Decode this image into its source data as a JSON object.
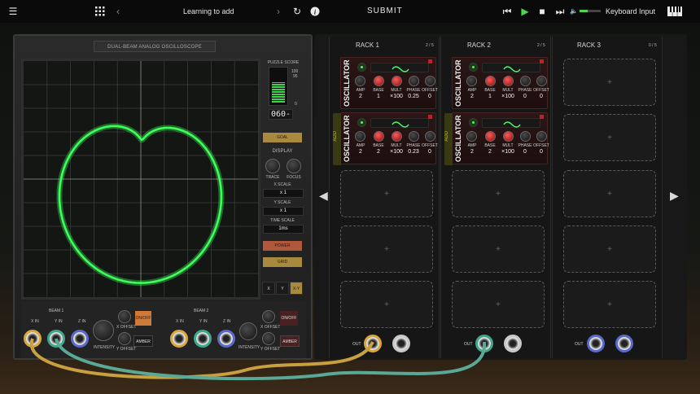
{
  "topbar": {
    "title": "Learning to add",
    "submit": "SUBMIT",
    "input_label": "Keyboard Input"
  },
  "scope": {
    "title": "DUAL-BEAM ANALOG OSCILLOSCOPE",
    "puzzle_score_label": "PUZZLE SCORE",
    "meter_ticks": [
      "100",
      "95",
      "0"
    ],
    "score_readout": "060-",
    "score_fraction": 0.6,
    "goal_button": "GOAL",
    "display_label": "DISPLAY",
    "trace_label": "TRACE",
    "focus_label": "FOCUS",
    "x_scale_label": "X SCALE",
    "x_scale_value": "x 1",
    "y_scale_label": "Y SCALE",
    "y_scale_value": "x 1",
    "time_scale_label": "TIME SCALE",
    "time_scale_value": "1ms",
    "power_button": "POWER",
    "grid_button": "GRID",
    "mode_buttons": [
      "X",
      "Y",
      "X-Y"
    ],
    "trace_color": "#3cff5a"
  },
  "beams": [
    {
      "label": "BEAM 1",
      "inputs": [
        "X IN",
        "Y IN",
        "Z IN"
      ],
      "intensity": "INTENSITY",
      "x_offset": "X OFFSET",
      "y_offset": "Y OFFSET",
      "onoff": "ON/OFF",
      "color_btn": "AMBER"
    },
    {
      "label": "BEAM 2",
      "inputs": [
        "X IN",
        "Y IN",
        "Z IN"
      ],
      "intensity": "INTENSITY",
      "x_offset": "X OFFSET",
      "y_offset": "Y OFFSET",
      "onoff": "ON/OFF",
      "color_btn": "AMBER"
    }
  ],
  "racks": [
    {
      "name": "RACK 1",
      "count": "2 / 5",
      "modules": [
        {
          "type": "OSCILLATOR",
          "labels": [
            "AMP",
            "BASE",
            "MULT",
            "PHASE",
            "OFFSET"
          ],
          "values": [
            "2",
            "1",
            "×100",
            "0.25",
            "0"
          ]
        },
        {
          "type": "OSCILLATOR",
          "labels": [
            "AMP",
            "BASE",
            "MULT",
            "PHASE",
            "OFFSET"
          ],
          "values": [
            "2",
            "2",
            "×100",
            "0.23",
            "0"
          ],
          "add_tab": "ADD"
        }
      ],
      "out_label": "OUT"
    },
    {
      "name": "RACK 2",
      "count": "2 / 5",
      "modules": [
        {
          "type": "OSCILLATOR",
          "labels": [
            "AMP",
            "BASE",
            "MULT",
            "PHASE",
            "OFFSET"
          ],
          "values": [
            "2",
            "1",
            "×100",
            "0",
            "0"
          ]
        },
        {
          "type": "OSCILLATOR",
          "labels": [
            "AMP",
            "BASE",
            "MULT",
            "PHASE",
            "OFFSET"
          ],
          "values": [
            "2",
            "2",
            "×100",
            "0",
            "0"
          ],
          "add_tab": "ADD"
        }
      ],
      "out_label": "OUT"
    },
    {
      "name": "RACK 3",
      "count": "0 / 5",
      "modules": [],
      "out_label": "OUT"
    }
  ]
}
